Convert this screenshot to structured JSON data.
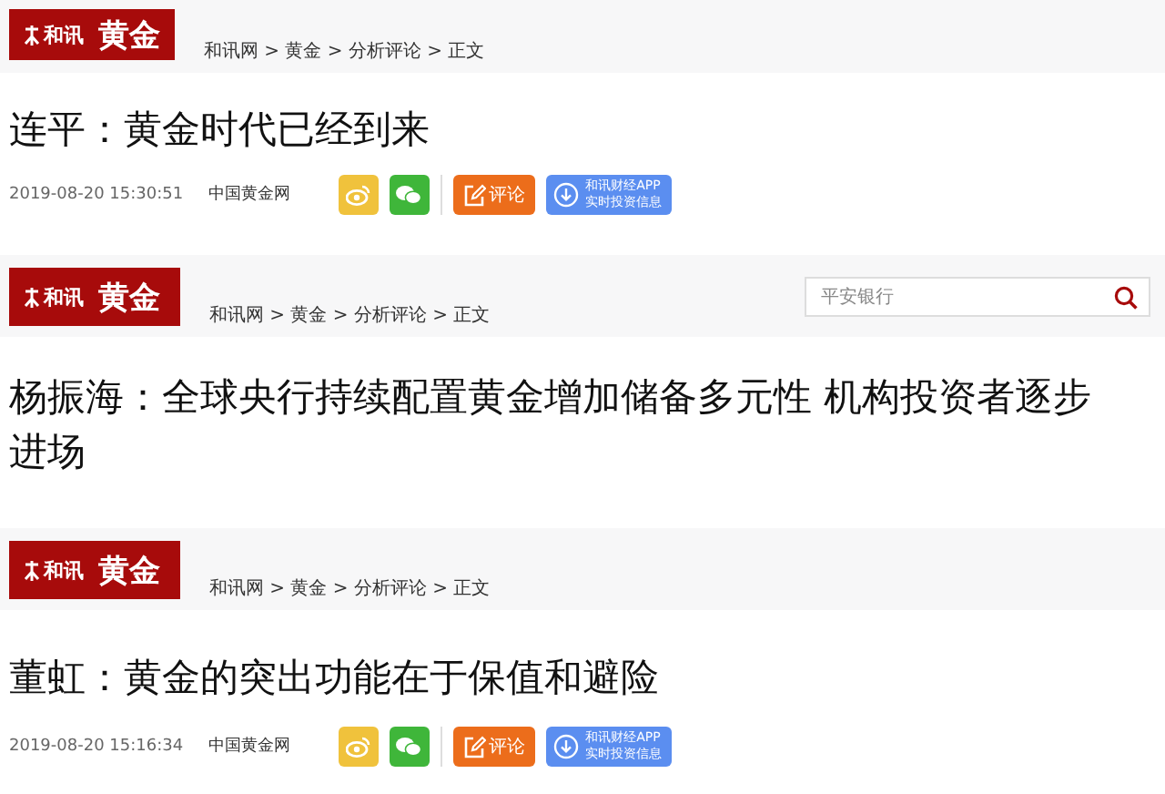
{
  "articles": [
    {
      "logo": {
        "brand": "和讯",
        "section": "黄金"
      },
      "breadcrumb": "和讯网 > 黄金 > 分析评论 > 正文",
      "title": "连平：黄金时代已经到来",
      "meta": {
        "date": "2019-08-20 15:30:51",
        "source": "中国黄金网",
        "share": [
          {
            "kind": "weibo"
          },
          {
            "kind": "wechat"
          }
        ],
        "comment_label": "评论",
        "app_lines": [
          "和讯财经APP",
          "实时投资信息"
        ]
      }
    },
    {
      "logo": {
        "brand": "和讯",
        "section": "黄金"
      },
      "breadcrumb": "和讯网 > 黄金 > 分析评论 > 正文",
      "search": {
        "placeholder": "平安银行"
      },
      "title": "杨振海：全球央行持续配置黄金增加储备多元性 机构投资者逐步进场"
    },
    {
      "logo": {
        "brand": "和讯",
        "section": "黄金"
      },
      "breadcrumb": "和讯网 > 黄金 > 分析评论 > 正文",
      "title": "董虹：黄金的突出功能在于保值和避险",
      "meta": {
        "date": "2019-08-20 15:16:34",
        "source": "中国黄金网",
        "share": [
          {
            "kind": "weibo"
          },
          {
            "kind": "wechat"
          }
        ],
        "comment_label": "评论",
        "app_lines": [
          "和讯财经APP",
          "实时投资信息"
        ]
      }
    }
  ]
}
